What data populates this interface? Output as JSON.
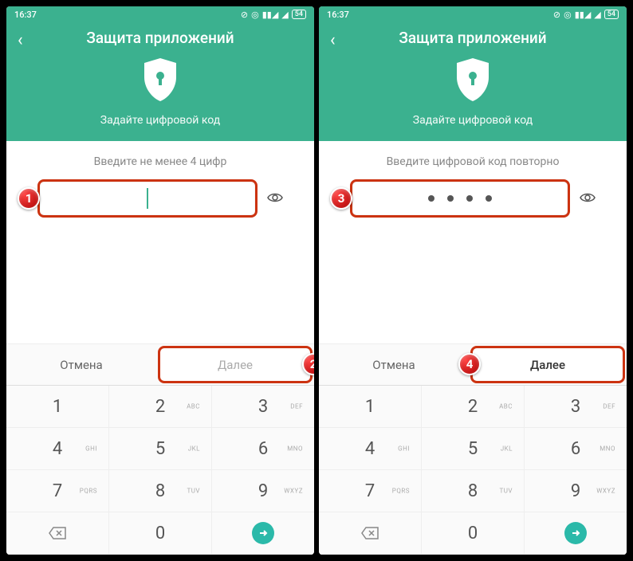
{
  "status": {
    "time": "16:37",
    "battery": "54"
  },
  "header": {
    "title": "Защита приложений",
    "subtitle": "Задайте цифровой код"
  },
  "screen1": {
    "prompt": "Введите не менее 4 цифр",
    "cancel": "Отмена",
    "next": "Далее"
  },
  "screen2": {
    "prompt": "Введите цифровой код повторно",
    "cancel": "Отмена",
    "next": "Далее"
  },
  "keypad": {
    "keys": [
      {
        "n": "1",
        "l": ""
      },
      {
        "n": "2",
        "l": "ABC"
      },
      {
        "n": "3",
        "l": "DEF"
      },
      {
        "n": "4",
        "l": "GHI"
      },
      {
        "n": "5",
        "l": "JKL"
      },
      {
        "n": "6",
        "l": "MNO"
      },
      {
        "n": "7",
        "l": "PQRS"
      },
      {
        "n": "8",
        "l": "TUV"
      },
      {
        "n": "9",
        "l": "WXYZ"
      }
    ],
    "zero": "0"
  },
  "markers": {
    "m1": "1",
    "m2": "2",
    "m3": "3",
    "m4": "4"
  }
}
